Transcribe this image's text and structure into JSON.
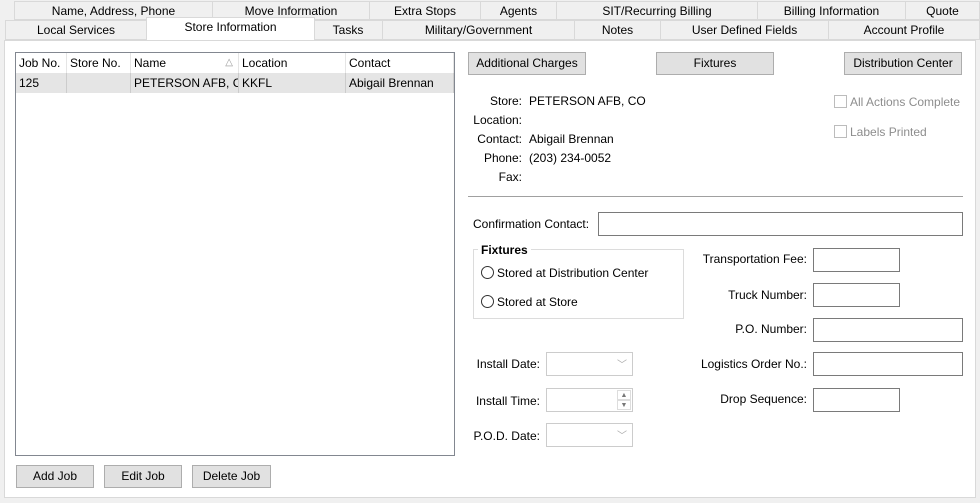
{
  "tabs_row1": [
    "Name, Address, Phone",
    "Move Information",
    "Extra Stops",
    "Agents",
    "SIT/Recurring Billing",
    "Billing Information",
    "Quote"
  ],
  "tabs_row2": [
    "Local Services",
    "Store Information",
    "Tasks",
    "Military/Government",
    "Notes",
    "User Defined Fields",
    "Account Profile"
  ],
  "selected_tab": "Store Information",
  "grid": {
    "columns": [
      "Job No.",
      "Store No.",
      "Name",
      "Location",
      "Contact"
    ],
    "sort_icon": "sort-triangle-icon",
    "rows": [
      [
        "125",
        "",
        "PETERSON AFB, C",
        "KKFL",
        "Abigail Brennan"
      ]
    ]
  },
  "buttons": {
    "add_job": "Add Job",
    "edit_job": "Edit Job",
    "delete_job": "Delete Job",
    "additional_charges": "Additional Charges",
    "fixtures": "Fixtures",
    "distribution_center": "Distribution Center"
  },
  "store_info": {
    "store_label": "Store:",
    "store": "PETERSON AFB, CO",
    "location_label": "Location:",
    "location": "",
    "contact_label": "Contact:",
    "contact": "Abigail Brennan",
    "phone_label": "Phone:",
    "phone": "(203) 234-0052",
    "fax_label": "Fax:",
    "fax": ""
  },
  "checks": {
    "all_actions": "All Actions Complete",
    "labels_printed": "Labels Printed"
  },
  "form": {
    "confirmation_contact": "Confirmation Contact:",
    "fixtures_group": "Fixtures",
    "radio_dc": "Stored at Distribution Center",
    "radio_store": "Stored at Store",
    "install_date": "Install Date:",
    "install_time": "Install Time:",
    "pod_date": "P.O.D. Date:",
    "transportation_fee": "Transportation Fee:",
    "truck_number": "Truck Number:",
    "po_number": "P.O. Number:",
    "logistics_order": "Logistics Order No.:",
    "drop_sequence": "Drop Sequence:"
  }
}
